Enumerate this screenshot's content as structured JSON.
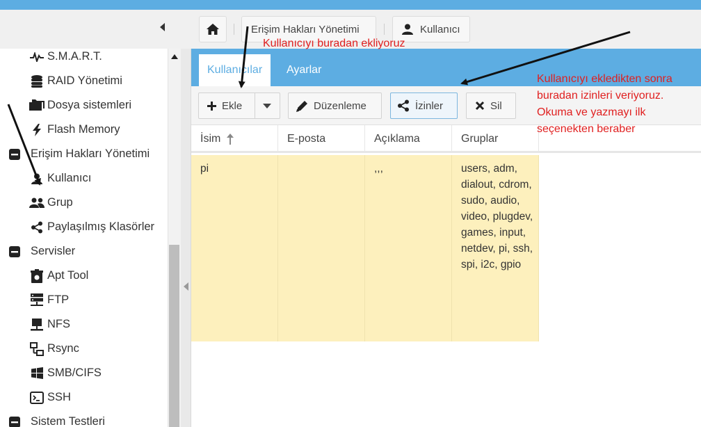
{
  "breadcrumb": {
    "home_icon": "home-icon",
    "items": [
      "Erişim Hakları Yönetimi",
      "Kullanıcı"
    ]
  },
  "sidebar": {
    "items": [
      {
        "label": "S.M.A.R.T.",
        "icon": "pulse-icon"
      },
      {
        "label": "RAID Yönetimi",
        "icon": "database-icon"
      },
      {
        "label": "Dosya sistemleri",
        "icon": "folders-icon"
      },
      {
        "label": "Flash Memory",
        "icon": "flash-icon"
      },
      {
        "label": "Erişim Hakları Yönetimi",
        "icon": "minus-box-icon",
        "group": true
      },
      {
        "label": "Kullanıcı",
        "icon": "user-icon"
      },
      {
        "label": "Grup",
        "icon": "group-icon"
      },
      {
        "label": "Paylaşılmış Klasörler",
        "icon": "share-icon"
      },
      {
        "label": "Servisler",
        "icon": "minus-box-icon",
        "group": true
      },
      {
        "label": "Apt Tool",
        "icon": "package-icon"
      },
      {
        "label": "FTP",
        "icon": "server-icon"
      },
      {
        "label": "NFS",
        "icon": "nfs-icon"
      },
      {
        "label": "Rsync",
        "icon": "network-icon"
      },
      {
        "label": "SMB/CIFS",
        "icon": "windows-icon"
      },
      {
        "label": "SSH",
        "icon": "terminal-icon"
      },
      {
        "label": "Sistem Testleri",
        "icon": "minus-box-icon",
        "group": true
      }
    ]
  },
  "tabs": [
    "Kullanıcılar",
    "Ayarlar"
  ],
  "toolbar": {
    "add": "Ekle",
    "edit": "Düzenleme",
    "permissions": "İzinler",
    "delete": "Sil"
  },
  "table": {
    "columns": [
      "İsim",
      "E-posta",
      "Açıklama",
      "Gruplar"
    ],
    "rows": [
      {
        "name": "pi",
        "email": "",
        "description": ",,,",
        "groups": "users, adm, dialout, cdrom, sudo, audio, video, plugdev, games, input, netdev, pi, ssh, spi, i2c, gpio"
      }
    ]
  },
  "annotations": {
    "add_note": "Kullanıcıyı buradan ekliyoruz",
    "perm_note_lines": [
      "Kullanıcıyı ekledikten sonra",
      "buradan izinleri veriyoruz.",
      "Okuma ve yazmayı ilk",
      "seçenekten beraber"
    ]
  },
  "colors": {
    "accent": "#5dade2",
    "selected_row": "#fdf0bd",
    "annotation": "#e02020"
  }
}
